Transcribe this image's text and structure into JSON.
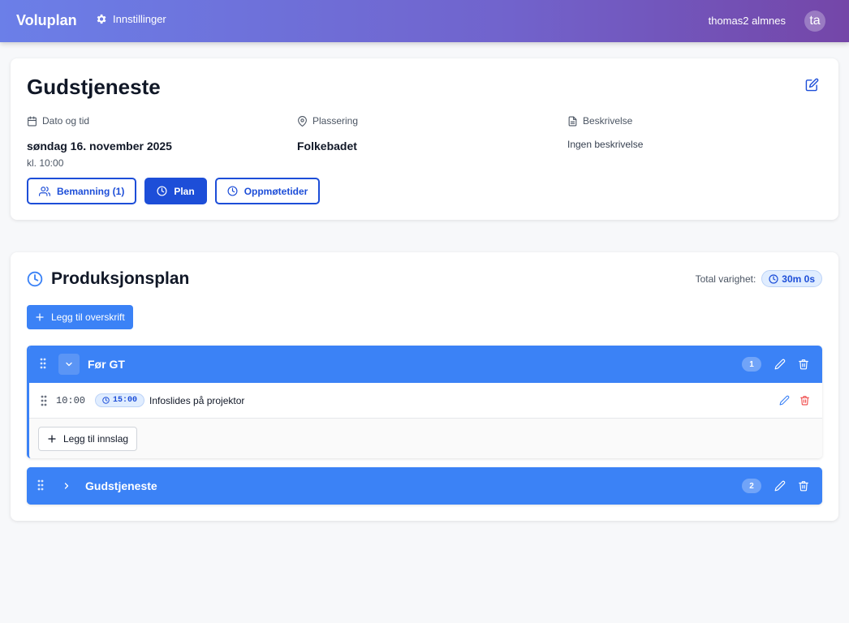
{
  "header": {
    "brand": "Voluplan",
    "settings_label": "Innstillinger",
    "user_name": "thomas2 almnes",
    "avatar_initials": "ta"
  },
  "event": {
    "title": "Gudstjeneste",
    "date_label": "Dato og tid",
    "date_value": "søndag 16. november 2025",
    "time_value": "kl. 10:00",
    "location_label": "Plassering",
    "location_value": "Folkebadet",
    "description_label": "Beskrivelse",
    "description_value": "Ingen beskrivelse",
    "tabs": [
      {
        "label": "Bemanning (1)",
        "icon": "users-icon",
        "active": false
      },
      {
        "label": "Plan",
        "icon": "clock-icon",
        "active": true
      },
      {
        "label": "Oppmøtetider",
        "icon": "clock-icon",
        "active": false
      }
    ]
  },
  "plan": {
    "title": "Produksjonsplan",
    "total_label": "Total varighet:",
    "total_value": "30m 0s",
    "add_heading_label": "Legg til overskrift",
    "sections": [
      {
        "title": "Før GT",
        "count": "1",
        "expanded": true,
        "items": [
          {
            "time": "10:00",
            "duration": "15:00",
            "title": "Infoslides på projektor"
          }
        ],
        "add_item_label": "Legg til innslag"
      },
      {
        "title": "Gudstjeneste",
        "count": "2",
        "expanded": false
      }
    ]
  },
  "colors": {
    "primary": "#3b82f6",
    "primary_dark": "#1d4ed8",
    "danger": "#ef4444",
    "header_gradient_start": "#6b7fe8",
    "header_gradient_end": "#7446a8"
  }
}
